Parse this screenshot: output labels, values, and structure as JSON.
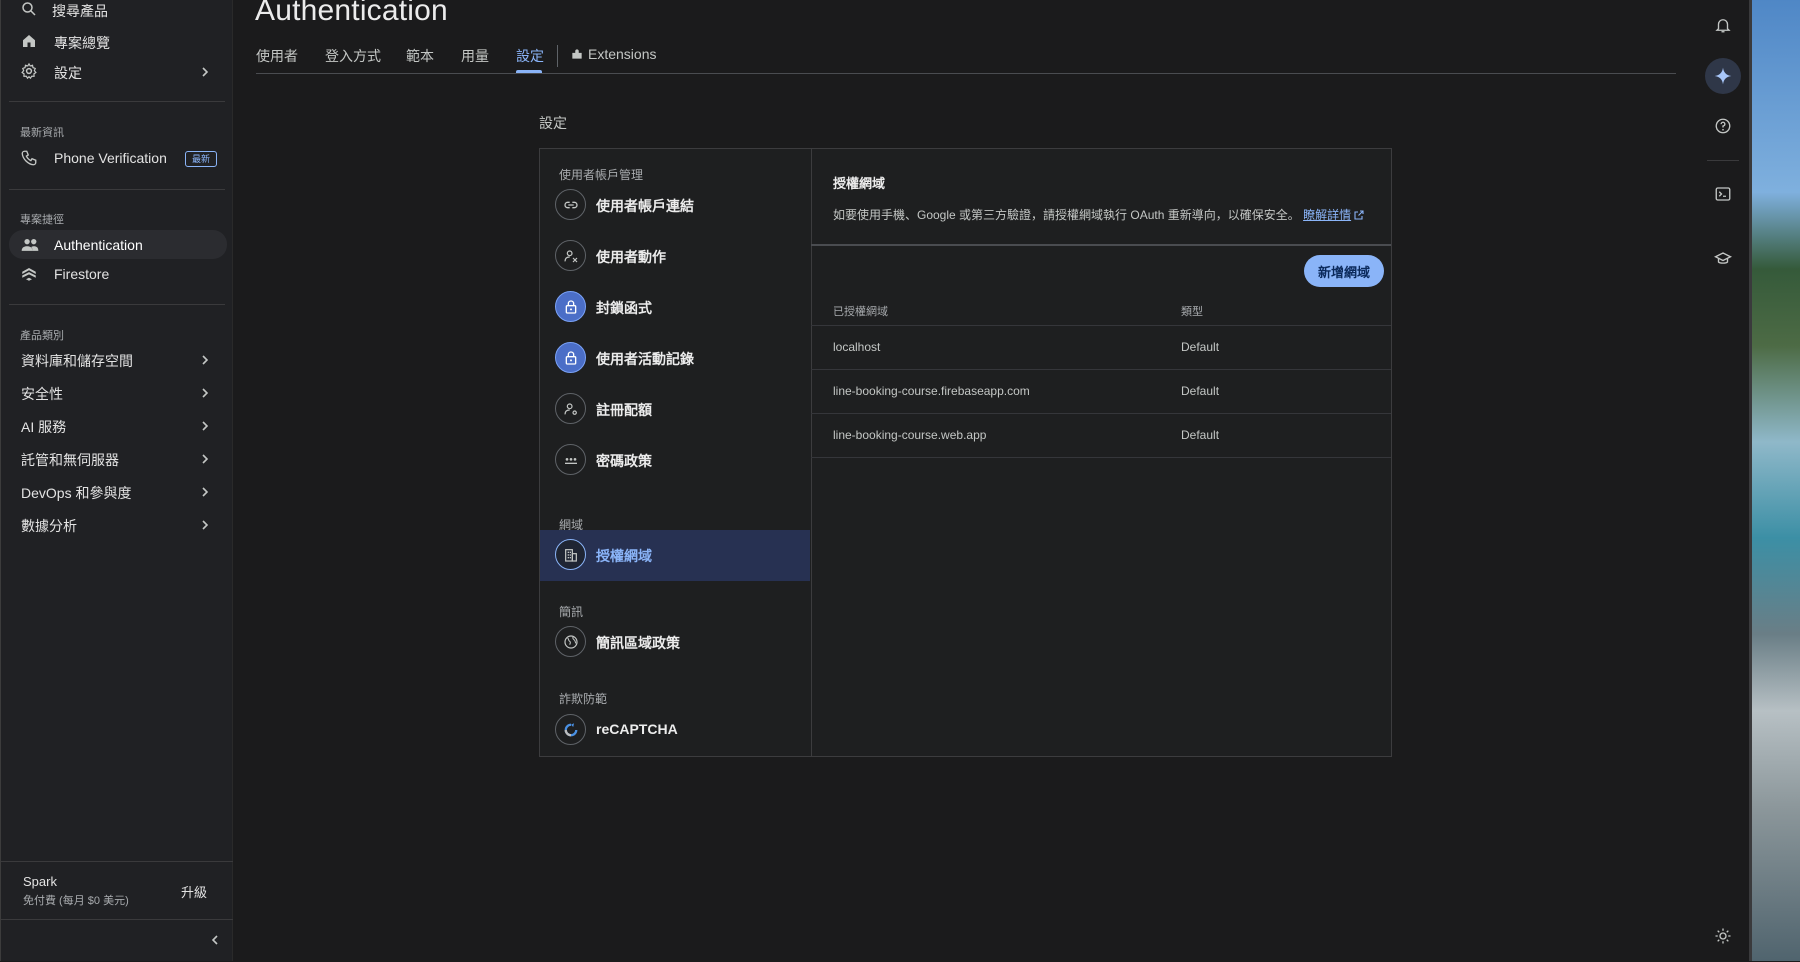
{
  "sidebar": {
    "search_label": "搜尋產品",
    "overview_label": "專案總覽",
    "settings_label": "設定",
    "news_section": "最新資訊",
    "news_item": "Phone Verification",
    "news_badge": "最新",
    "shortcuts_section": "專案捷徑",
    "shortcuts": [
      {
        "label": "Authentication"
      },
      {
        "label": "Firestore"
      }
    ],
    "categories_section": "產品類別",
    "categories": [
      {
        "label": "資料庫和儲存空間"
      },
      {
        "label": "安全性"
      },
      {
        "label": "AI 服務"
      },
      {
        "label": "託管和無伺服器"
      },
      {
        "label": "DevOps 和參與度"
      },
      {
        "label": "數據分析"
      }
    ],
    "plan": {
      "name": "Spark",
      "desc": "免付費 (每月 $0 美元)",
      "upgrade": "升級"
    }
  },
  "header": {
    "title": "Authentication",
    "tabs": [
      {
        "label": "使用者"
      },
      {
        "label": "登入方式"
      },
      {
        "label": "範本"
      },
      {
        "label": "用量"
      },
      {
        "label": "設定"
      },
      {
        "label": "Extensions"
      }
    ],
    "active_tab": "設定"
  },
  "settings": {
    "heading": "設定",
    "menu": {
      "group_account": "使用者帳戶管理",
      "items_account": [
        {
          "label": "使用者帳戶連結",
          "icon": "link-icon"
        },
        {
          "label": "使用者動作",
          "icon": "person-remove-icon"
        },
        {
          "label": "封鎖函式",
          "icon": "lock-icon"
        },
        {
          "label": "使用者活動記錄",
          "icon": "lock-icon"
        },
        {
          "label": "註冊配額",
          "icon": "person-settings-icon"
        },
        {
          "label": "密碼政策",
          "icon": "password-icon"
        }
      ],
      "group_domains": "網域",
      "item_domains": {
        "label": "授權網域",
        "icon": "building-icon"
      },
      "group_sms": "簡訊",
      "item_sms": {
        "label": "簡訊區域政策",
        "icon": "globe-icon"
      },
      "group_fraud": "詐欺防範",
      "item_fraud": {
        "label": "reCAPTCHA",
        "icon": "recaptcha-icon"
      }
    },
    "panel": {
      "title": "授權網域",
      "description": "如要使用手機、Google 或第三方驗證，請授權網域執行 OAuth 重新導向，以確保安全。",
      "learn_more": "瞭解詳情",
      "add_button": "新增網域",
      "columns": [
        "已授權網域",
        "類型"
      ],
      "rows": [
        {
          "domain": "localhost",
          "type": "Default"
        },
        {
          "domain": "line-booking-course.firebaseapp.com",
          "type": "Default"
        },
        {
          "domain": "line-booking-course.web.app",
          "type": "Default"
        }
      ]
    }
  },
  "colors": {
    "accent": "#8ab4f8",
    "background": "#1b1b1c",
    "selected_row": "#273152"
  }
}
